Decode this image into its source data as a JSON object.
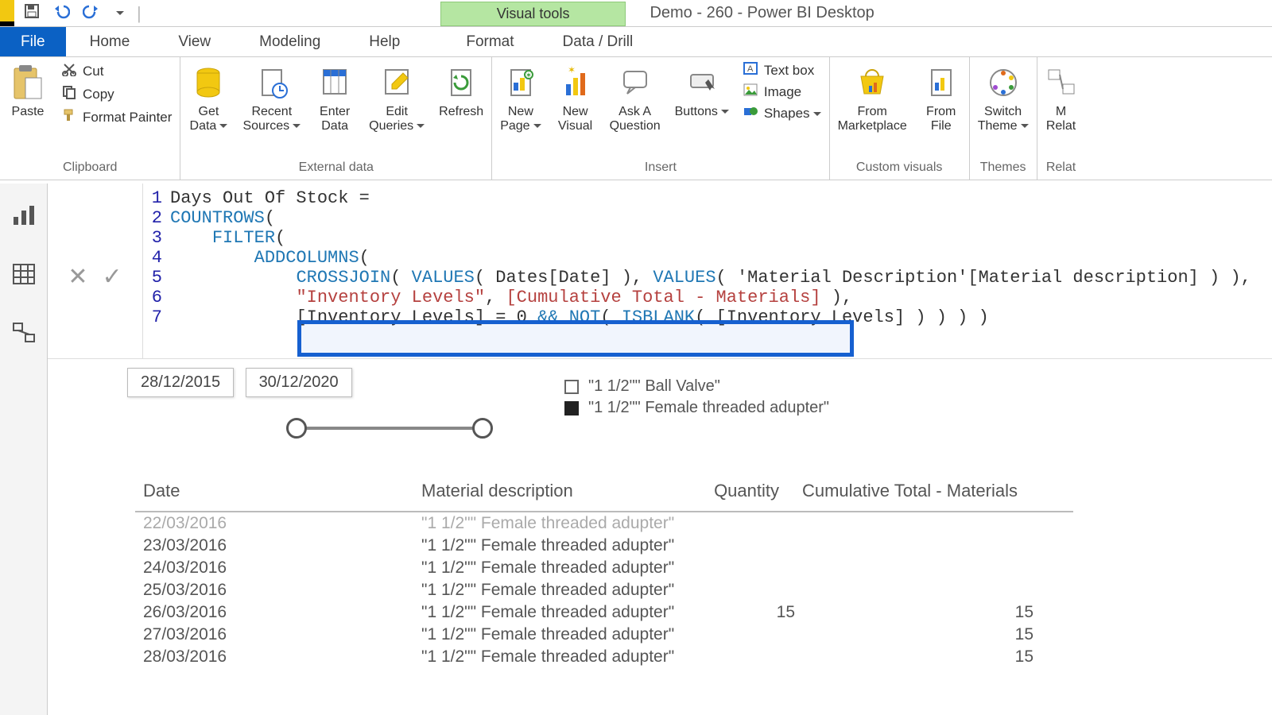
{
  "app_title": "Demo - 260 - Power BI Desktop",
  "title_context": "Visual tools",
  "qat": {
    "save": "save-icon",
    "undo": "undo-icon",
    "redo": "redo-icon",
    "customize": "customize-icon"
  },
  "menu": {
    "file": "File",
    "tabs": [
      "Home",
      "View",
      "Modeling",
      "Help"
    ],
    "context_tabs": [
      "Format",
      "Data / Drill"
    ]
  },
  "ribbon": {
    "clipboard": {
      "label": "Clipboard",
      "paste": "Paste",
      "cut": "Cut",
      "copy": "Copy",
      "format_painter": "Format Painter"
    },
    "external": {
      "label": "External data",
      "get_data": "Get\nData",
      "recent": "Recent\nSources",
      "enter": "Enter\nData",
      "edit_q": "Edit\nQueries",
      "refresh": "Refresh"
    },
    "insert": {
      "label": "Insert",
      "new_page": "New\nPage",
      "new_visual": "New\nVisual",
      "ask": "Ask A\nQuestion",
      "buttons": "Buttons",
      "textbox": "Text box",
      "image": "Image",
      "shapes": "Shapes"
    },
    "custom": {
      "label": "Custom visuals",
      "market": "From\nMarketplace",
      "file": "From\nFile"
    },
    "themes": {
      "label": "Themes",
      "switch": "Switch\nTheme"
    },
    "relationships": {
      "label": "Relat",
      "manage": "M\nRelat"
    }
  },
  "formula": {
    "accept": "✓",
    "cancel": "✕",
    "lines": [
      "Days Out Of Stock =",
      "COUNTROWS(",
      "    FILTER(",
      "        ADDCOLUMNS(",
      "            CROSSJOIN( VALUES( Dates[Date] ), VALUES( 'Material Description'[Material description] ) ),",
      "            \"Inventory Levels\", [Cumulative Total - Materials] ),",
      "            [Inventory Levels] = 0 && NOT( ISBLANK( [Inventory Levels] ) ) ) )"
    ]
  },
  "slicer": {
    "from": "28/12/2015",
    "to": "30/12/2020"
  },
  "legend": {
    "items": [
      {
        "filled": false,
        "label": "\"1 1/2\"\" Ball Valve\""
      },
      {
        "filled": true,
        "label": "\"1 1/2\"\" Female threaded adupter\""
      }
    ]
  },
  "table": {
    "headers": {
      "date": "Date",
      "mat": "Material description",
      "qty": "Quantity",
      "cum": "Cumulative Total - Materials"
    },
    "rows": [
      {
        "date": "22/03/2016",
        "mat": "\"1 1/2\"\" Female threaded adupter\"",
        "qty": "",
        "cum": "",
        "faded": true
      },
      {
        "date": "23/03/2016",
        "mat": "\"1 1/2\"\" Female threaded adupter\"",
        "qty": "",
        "cum": ""
      },
      {
        "date": "24/03/2016",
        "mat": "\"1 1/2\"\" Female threaded adupter\"",
        "qty": "",
        "cum": ""
      },
      {
        "date": "25/03/2016",
        "mat": "\"1 1/2\"\" Female threaded adupter\"",
        "qty": "",
        "cum": ""
      },
      {
        "date": "26/03/2016",
        "mat": "\"1 1/2\"\" Female threaded adupter\"",
        "qty": "15",
        "cum": "15"
      },
      {
        "date": "27/03/2016",
        "mat": "\"1 1/2\"\" Female threaded adupter\"",
        "qty": "",
        "cum": "15"
      },
      {
        "date": "28/03/2016",
        "mat": "\"1 1/2\"\" Female threaded adupter\"",
        "qty": "",
        "cum": "15"
      }
    ]
  }
}
